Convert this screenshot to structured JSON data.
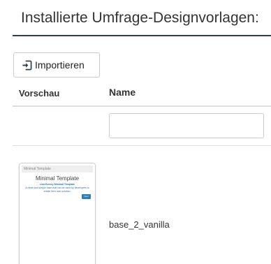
{
  "page": {
    "title": "Installierte Umfrage-Designvorlagen:"
  },
  "toolbar": {
    "import_label": "Importieren",
    "import_icon": "import-icon"
  },
  "table": {
    "columns": [
      "Vorschau",
      "Name"
    ],
    "filter": {
      "value": "",
      "placeholder": ""
    },
    "rows": [
      {
        "name": "base_2_vanilla",
        "preview": {
          "bar_text": "Minimal Template",
          "title": "Minimal Template",
          "subtitle": "LimeSurvey Minimal Template",
          "description": "A clean and simple base that can be used by developers to create their own solution.",
          "button_label": "Next"
        }
      }
    ]
  },
  "colors": {
    "accent_rule": "#2c3e50",
    "primary": "#337ab7"
  }
}
